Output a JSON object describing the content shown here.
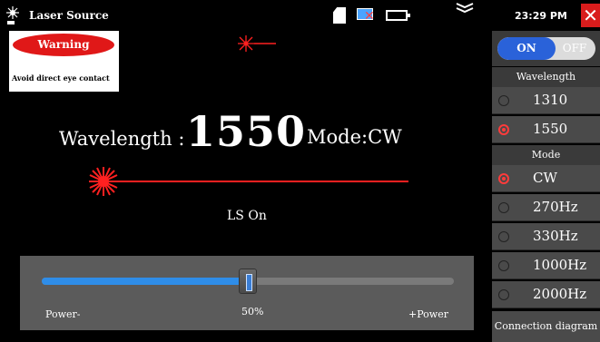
{
  "titlebar": {
    "title": "Laser Source",
    "time": "23:29 PM",
    "close_label": "✕"
  },
  "warning": {
    "badge": "Warning",
    "text": "Avoid direct eye contact"
  },
  "main": {
    "wavelength_label": "Wavelength :",
    "wavelength_value": "1550",
    "mode_label": "Mode:CW",
    "status": "LS On"
  },
  "power": {
    "minus_label": "Power-",
    "percent_label": "50%",
    "plus_label": "+Power",
    "level_fraction": 0.5
  },
  "right_panel": {
    "on_label": "ON",
    "off_label": "OFF",
    "wavelength_header": "Wavelength",
    "wavelength_options": [
      {
        "label": "1310",
        "selected": false
      },
      {
        "label": "1550",
        "selected": true
      }
    ],
    "mode_header": "Mode",
    "mode_options": [
      {
        "label": "CW",
        "selected": true
      },
      {
        "label": "270Hz",
        "selected": false
      },
      {
        "label": "330Hz",
        "selected": false
      },
      {
        "label": "1000Hz",
        "selected": false
      },
      {
        "label": "2000Hz",
        "selected": false
      }
    ],
    "connection_button": "Connection diagram"
  },
  "colors": {
    "accent_blue": "#2f8de8",
    "laser_red": "#ff2020",
    "warning_red": "#e01818",
    "toggle_blue": "#2a62d9"
  },
  "icons": [
    "laser-app-icon",
    "sd-card-icon",
    "network-error-icon",
    "battery-icon",
    "chevron-icon",
    "close-icon"
  ]
}
